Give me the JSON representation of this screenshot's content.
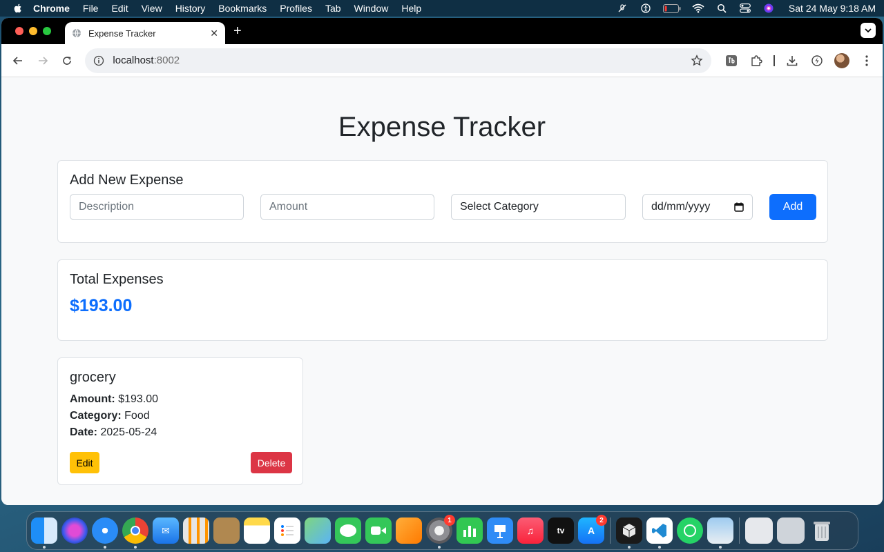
{
  "menubar": {
    "app": "Chrome",
    "items": [
      "File",
      "Edit",
      "View",
      "History",
      "Bookmarks",
      "Profiles",
      "Tab",
      "Window",
      "Help"
    ],
    "clock": "Sat 24 May  9:18 AM"
  },
  "browser": {
    "tab_title": "Expense Tracker",
    "url_host": "localhost",
    "url_port": ":8002"
  },
  "page": {
    "title": "Expense Tracker",
    "add_form": {
      "heading": "Add New Expense",
      "description_placeholder": "Description",
      "amount_placeholder": "Amount",
      "category_selected": "Select Category",
      "date_placeholder": "dd/mm/yyyy",
      "add_label": "Add"
    },
    "total": {
      "heading": "Total Expenses",
      "amount": "$193.00"
    },
    "expenses": [
      {
        "description": "grocery",
        "amount_label": "Amount:",
        "amount": "$193.00",
        "category_label": "Category:",
        "category": "Food",
        "date_label": "Date:",
        "date": "2025-05-24",
        "edit_label": "Edit",
        "delete_label": "Delete"
      }
    ]
  },
  "dock": {
    "apps": [
      "finder",
      "siri",
      "safari",
      "chrome",
      "mail",
      "launchpad",
      "contacts",
      "notes",
      "reminders",
      "maps",
      "messages",
      "facetime",
      "pages",
      "system-settings",
      "numbers",
      "keynote",
      "music",
      "apple-tv",
      "app-store",
      "cursor",
      "vscode",
      "whatsapp",
      "preview"
    ],
    "settings_badge": "1",
    "appstore_badge": "2"
  },
  "colors": {
    "primary": "#0d6efd",
    "warning": "#ffc107",
    "danger": "#dc3545"
  }
}
